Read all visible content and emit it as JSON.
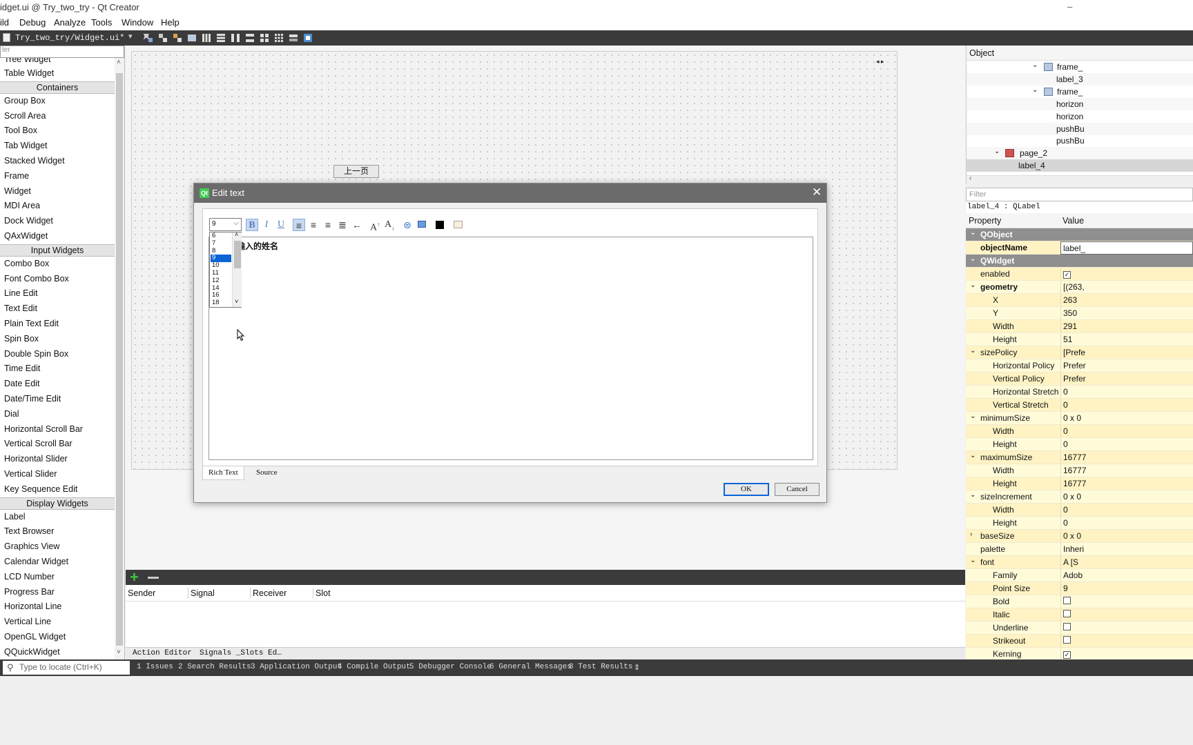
{
  "window": {
    "title": "Widget.ui @ Try_two_try - Qt Creator",
    "title_visible": "idget.ui @ Try_two_try - Qt Creator"
  },
  "menubar": {
    "items": [
      "ild",
      "Debug",
      "Analyze",
      "Tools",
      "Window",
      "Help"
    ]
  },
  "doc_toolbar": {
    "document": "Try_two_try/Widget.ui*"
  },
  "widget_box": {
    "filter_placeholder": "ter",
    "items": [
      {
        "type": "item",
        "label": "Tree Widget"
      },
      {
        "type": "item",
        "label": "Table Widget"
      },
      {
        "type": "cat",
        "label": "Containers"
      },
      {
        "type": "item",
        "label": "Group Box"
      },
      {
        "type": "item",
        "label": "Scroll Area"
      },
      {
        "type": "item",
        "label": "Tool Box"
      },
      {
        "type": "item",
        "label": "Tab Widget"
      },
      {
        "type": "item",
        "label": "Stacked Widget"
      },
      {
        "type": "item",
        "label": "Frame"
      },
      {
        "type": "item",
        "label": "Widget"
      },
      {
        "type": "item",
        "label": "MDI Area"
      },
      {
        "type": "item",
        "label": "Dock Widget"
      },
      {
        "type": "item",
        "label": "QAxWidget"
      },
      {
        "type": "cat",
        "label": "Input Widgets"
      },
      {
        "type": "item",
        "label": "Combo Box"
      },
      {
        "type": "item",
        "label": "Font Combo Box"
      },
      {
        "type": "item",
        "label": "Line Edit"
      },
      {
        "type": "item",
        "label": "Text Edit"
      },
      {
        "type": "item",
        "label": "Plain Text Edit"
      },
      {
        "type": "item",
        "label": "Spin Box"
      },
      {
        "type": "item",
        "label": "Double Spin Box"
      },
      {
        "type": "item",
        "label": "Time Edit"
      },
      {
        "type": "item",
        "label": "Date Edit"
      },
      {
        "type": "item",
        "label": "Date/Time Edit"
      },
      {
        "type": "item",
        "label": "Dial"
      },
      {
        "type": "item",
        "label": "Horizontal Scroll Bar"
      },
      {
        "type": "item",
        "label": "Vertical Scroll Bar"
      },
      {
        "type": "item",
        "label": "Horizontal Slider"
      },
      {
        "type": "item",
        "label": "Vertical Slider"
      },
      {
        "type": "item",
        "label": "Key Sequence Edit"
      },
      {
        "type": "cat",
        "label": "Display Widgets"
      },
      {
        "type": "item",
        "label": "Label"
      },
      {
        "type": "item",
        "label": "Text Browser"
      },
      {
        "type": "item",
        "label": "Graphics View"
      },
      {
        "type": "item",
        "label": "Calendar Widget"
      },
      {
        "type": "item",
        "label": "LCD Number"
      },
      {
        "type": "item",
        "label": "Progress Bar"
      },
      {
        "type": "item",
        "label": "Horizontal Line"
      },
      {
        "type": "item",
        "label": "Vertical Line"
      },
      {
        "type": "item",
        "label": "OpenGL Widget"
      },
      {
        "type": "item",
        "label": "QQuickWidget"
      }
    ]
  },
  "canvas": {
    "prev_button": "上一页"
  },
  "dialog": {
    "title": "Edit text",
    "font_size": "9",
    "size_options": [
      "6",
      "7",
      "8",
      "9",
      "10",
      "11",
      "12",
      "14",
      "16",
      "18"
    ],
    "selected_size": "9",
    "text": "请输入的姓名",
    "text_visible": "输入的姓名",
    "tabs": [
      "Rich Text",
      "Source"
    ],
    "ok": "OK",
    "cancel": "Cancel"
  },
  "signals_slots": {
    "columns": [
      "Sender",
      "Signal",
      "Receiver",
      "Slot"
    ]
  },
  "bottom_tabs": [
    "Action Editor",
    "Signals _Slots Ed…"
  ],
  "statusbar": {
    "locate_placeholder": "Type to locate (Ctrl+K)",
    "panes": [
      "1 Issues",
      "2 Search Results",
      "3 Application Output",
      "4 Compile Output",
      "5 Debugger Console",
      "6 General Messages",
      "8 Test Results"
    ]
  },
  "object_inspector": {
    "header": "Object",
    "rows": [
      {
        "label": "frame_",
        "has_arrow": true,
        "icon": "frame"
      },
      {
        "label": "label_3",
        "has_arrow": false,
        "icon": ""
      },
      {
        "label": "frame_",
        "has_arrow": true,
        "icon": "frame"
      },
      {
        "label": "horizon",
        "has_arrow": false,
        "icon": ""
      },
      {
        "label": "horizon",
        "has_arrow": false,
        "icon": ""
      },
      {
        "label": "pushBu",
        "has_arrow": false,
        "icon": ""
      },
      {
        "label": "pushBu",
        "has_arrow": false,
        "icon": ""
      },
      {
        "label": "page_2",
        "has_arrow": true,
        "icon": "page"
      },
      {
        "label": "label_4",
        "has_arrow": false,
        "icon": ""
      }
    ]
  },
  "property_editor": {
    "filter_placeholder": "Filter",
    "class_line": "label_4 : QLabel",
    "col_property": "Property",
    "col_value": "Value",
    "rows": [
      {
        "k": "QObject",
        "v": "",
        "lvl": 0,
        "sec": true,
        "tw": "v"
      },
      {
        "k": "objectName",
        "v": "label_",
        "lvl": 0,
        "bold": true
      },
      {
        "k": "QWidget",
        "v": "",
        "lvl": 0,
        "sec": true,
        "tw": "v"
      },
      {
        "k": "enabled",
        "v": "",
        "lvl": 0,
        "cb": "checked"
      },
      {
        "k": "geometry",
        "v": "[(263,",
        "lvl": 0,
        "bold": true,
        "tw": "v"
      },
      {
        "k": "X",
        "v": "263",
        "lvl": 1
      },
      {
        "k": "Y",
        "v": "350",
        "lvl": 1
      },
      {
        "k": "Width",
        "v": "291",
        "lvl": 1
      },
      {
        "k": "Height",
        "v": "51",
        "lvl": 1
      },
      {
        "k": "sizePolicy",
        "v": "[Prefe",
        "lvl": 0,
        "tw": "v"
      },
      {
        "k": "Horizontal Policy",
        "v": "Prefer",
        "lvl": 1
      },
      {
        "k": "Vertical Policy",
        "v": "Prefer",
        "lvl": 1
      },
      {
        "k": "Horizontal Stretch",
        "v": "0",
        "lvl": 1
      },
      {
        "k": "Vertical Stretch",
        "v": "0",
        "lvl": 1
      },
      {
        "k": "minimumSize",
        "v": "0 x 0",
        "lvl": 0,
        "tw": "v"
      },
      {
        "k": "Width",
        "v": "0",
        "lvl": 1
      },
      {
        "k": "Height",
        "v": "0",
        "lvl": 1
      },
      {
        "k": "maximumSize",
        "v": "16777",
        "lvl": 0,
        "tw": "v"
      },
      {
        "k": "Width",
        "v": "16777",
        "lvl": 1
      },
      {
        "k": "Height",
        "v": "16777",
        "lvl": 1
      },
      {
        "k": "sizeIncrement",
        "v": "0 x 0",
        "lvl": 0,
        "tw": "v"
      },
      {
        "k": "Width",
        "v": "0",
        "lvl": 1
      },
      {
        "k": "Height",
        "v": "0",
        "lvl": 1
      },
      {
        "k": "baseSize",
        "v": "0 x 0",
        "lvl": 0,
        "tw": ">"
      },
      {
        "k": "palette",
        "v": "Inheri",
        "lvl": 0
      },
      {
        "k": "font",
        "v": "A  [S",
        "lvl": 0,
        "tw": "v"
      },
      {
        "k": "Family",
        "v": "Adob",
        "lvl": 1
      },
      {
        "k": "Point Size",
        "v": "9",
        "lvl": 1
      },
      {
        "k": "Bold",
        "v": "",
        "lvl": 1,
        "cb": "unchecked"
      },
      {
        "k": "Italic",
        "v": "",
        "lvl": 1,
        "cb": "unchecked"
      },
      {
        "k": "Underline",
        "v": "",
        "lvl": 1,
        "cb": "unchecked"
      },
      {
        "k": "Strikeout",
        "v": "",
        "lvl": 1,
        "cb": "unchecked"
      },
      {
        "k": "Kerning",
        "v": "",
        "lvl": 1,
        "cb": "checked"
      }
    ]
  },
  "colors": {
    "dark_bar": "#3b3b3b",
    "property_bg": "#fffbd9",
    "property_section": "#8f8f8f",
    "selection_blue": "#0a64d6",
    "qt_green": "#41cd52"
  }
}
